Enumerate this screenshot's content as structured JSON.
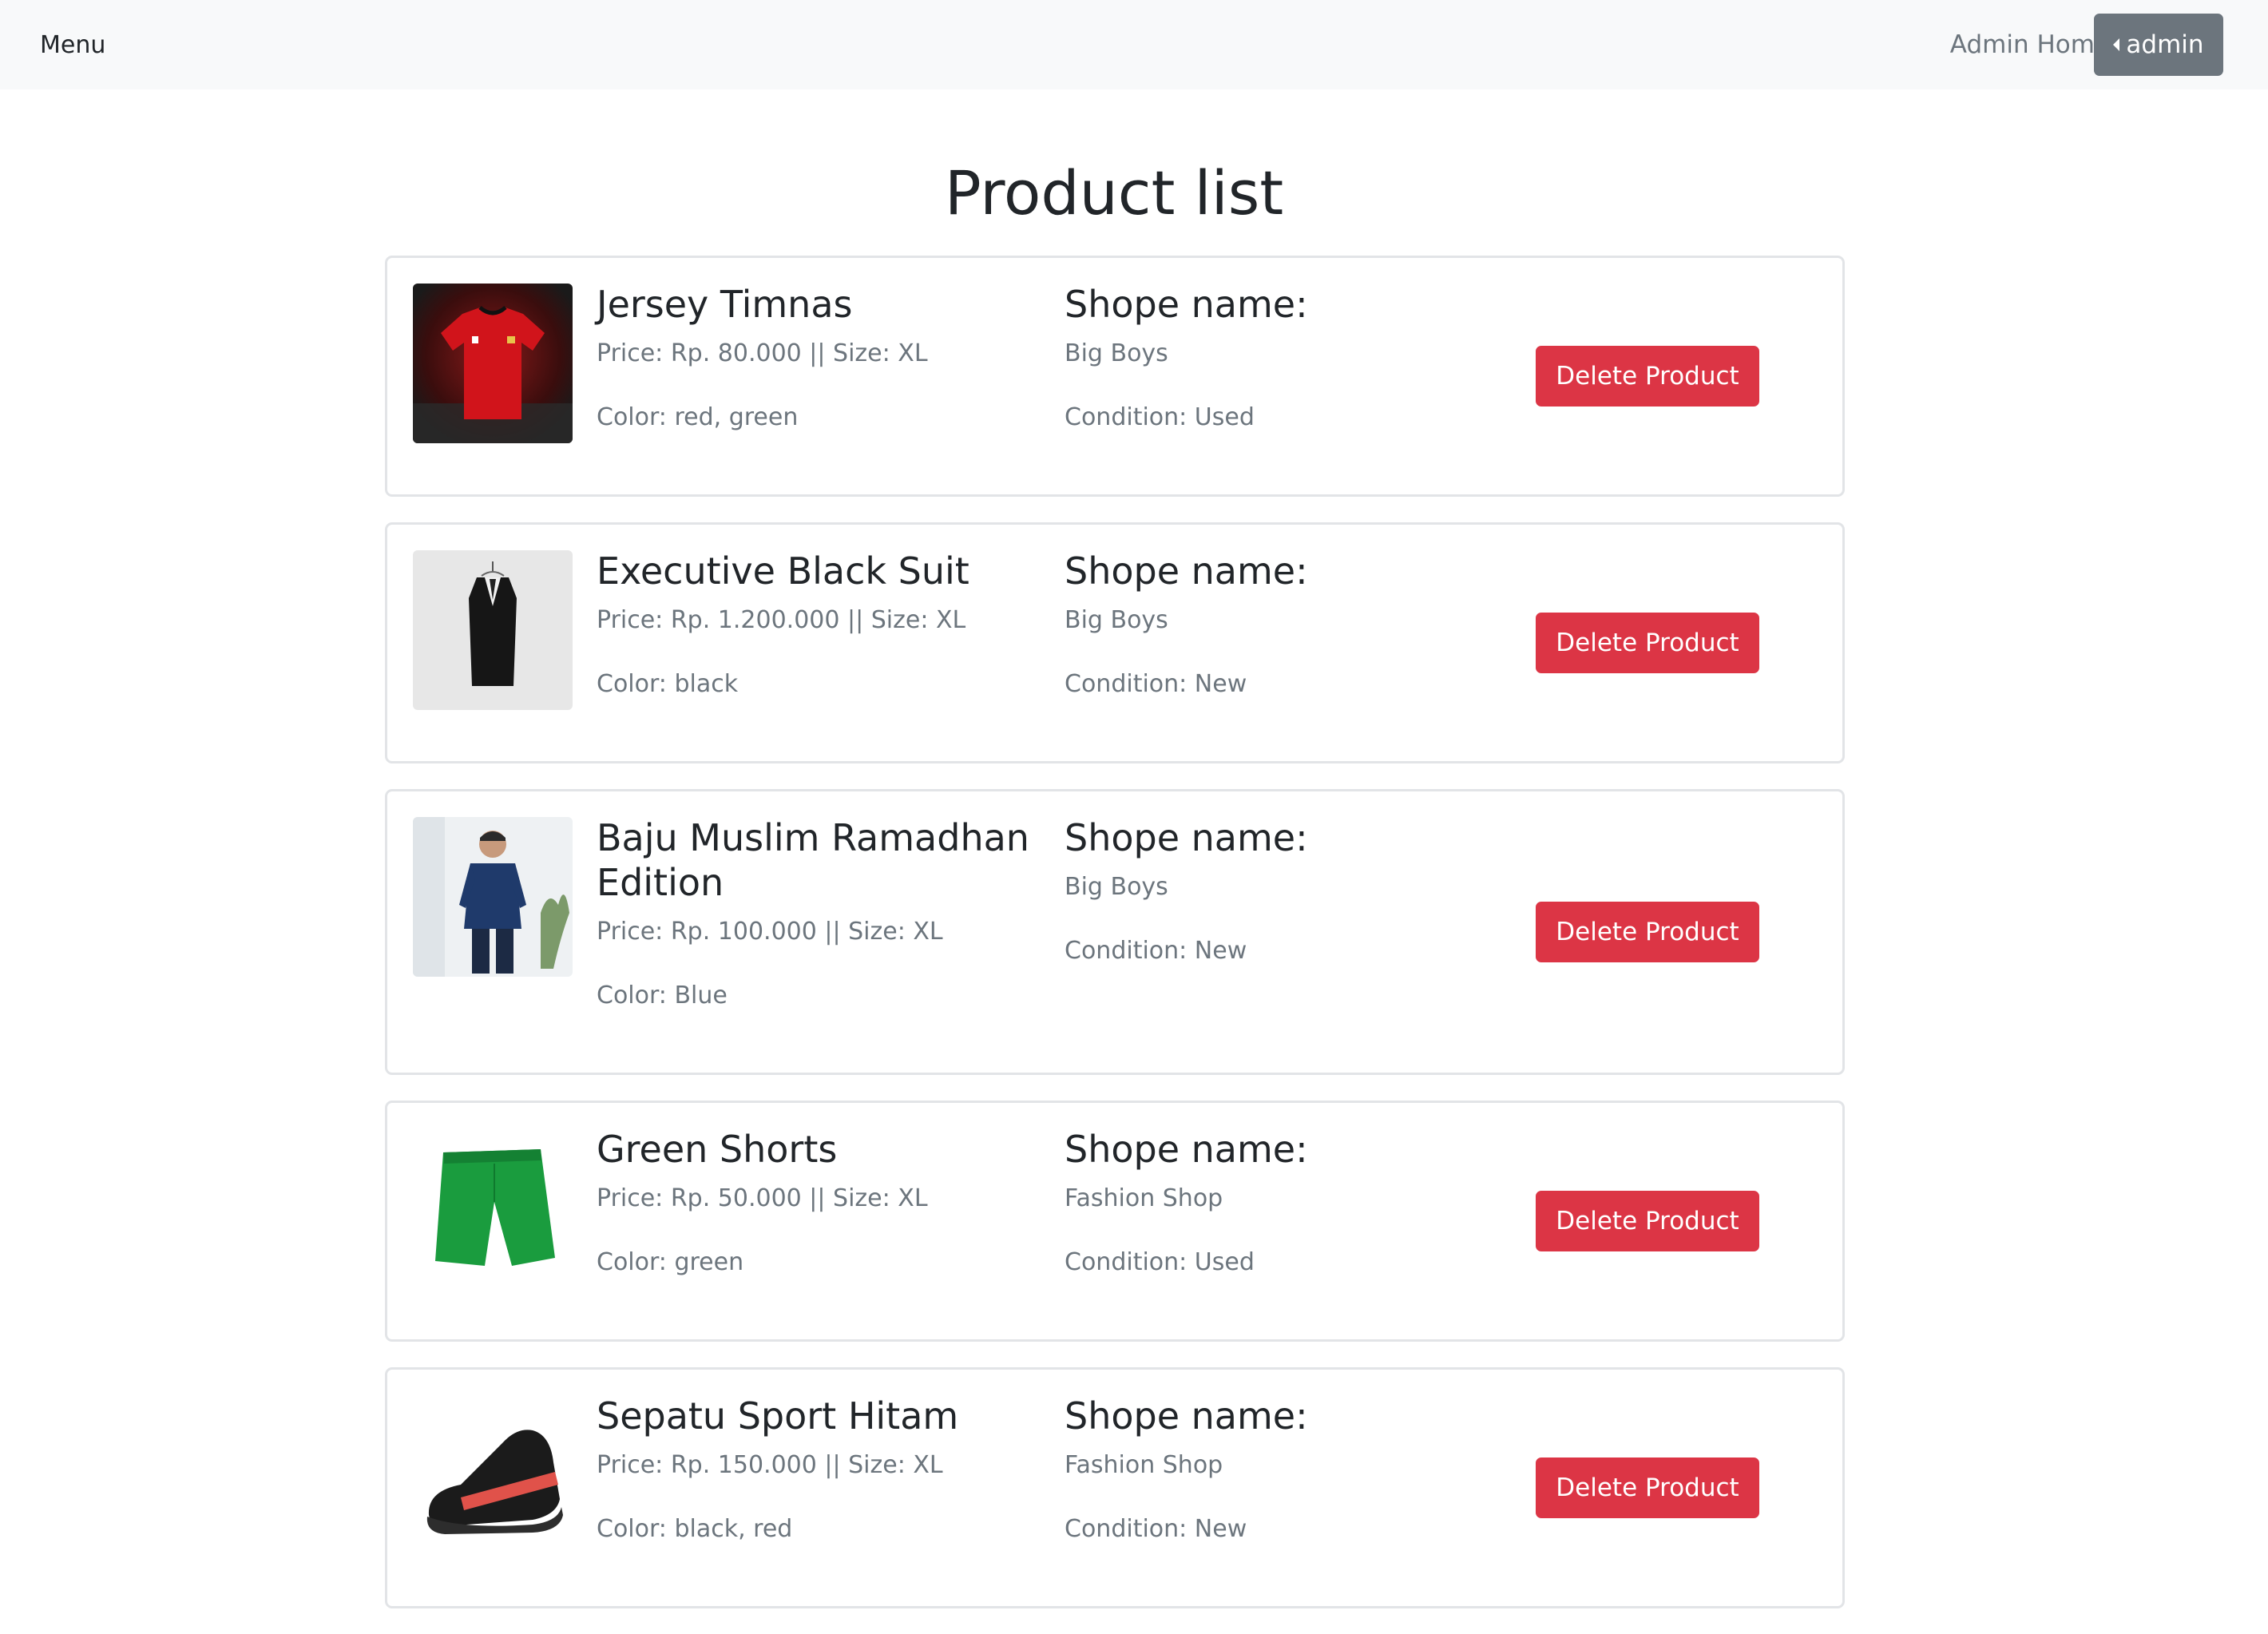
{
  "navbar": {
    "brand": "Menu",
    "link": "Admin Home",
    "user": "admin"
  },
  "page": {
    "title": "Product list"
  },
  "products": [
    {
      "name": "Jersey Timnas",
      "price_size": "Price: Rp. 80.000 || Size: XL",
      "color": "Color: red, green",
      "shop_label": "Shope name:",
      "shop_name": "Big Boys",
      "condition": "Condition: Used",
      "delete_label": "Delete Product"
    },
    {
      "name": "Executive Black Suit",
      "price_size": "Price: Rp. 1.200.000 || Size: XL",
      "color": "Color: black",
      "shop_label": "Shope name:",
      "shop_name": "Big Boys",
      "condition": "Condition: New",
      "delete_label": "Delete Product"
    },
    {
      "name": "Baju Muslim Ramadhan Edition",
      "price_size": "Price: Rp. 100.000 || Size: XL",
      "color": "Color: Blue",
      "shop_label": "Shope name:",
      "shop_name": "Big Boys",
      "condition": "Condition: New",
      "delete_label": "Delete Product"
    },
    {
      "name": "Green Shorts",
      "price_size": "Price: Rp. 50.000 || Size: XL",
      "color": "Color: green",
      "shop_label": "Shope name:",
      "shop_name": "Fashion Shop",
      "condition": "Condition: Used",
      "delete_label": "Delete Product"
    },
    {
      "name": "Sepatu Sport Hitam",
      "price_size": "Price: Rp. 150.000 || Size: XL",
      "color": "Color: black, red",
      "shop_label": "Shope name:",
      "shop_name": "Fashion Shop",
      "condition": "Condition: New",
      "delete_label": "Delete Product"
    }
  ],
  "colors": {
    "danger": "#dc3545",
    "secondary": "#6c757d",
    "navbar_bg": "#f8f9fa"
  }
}
